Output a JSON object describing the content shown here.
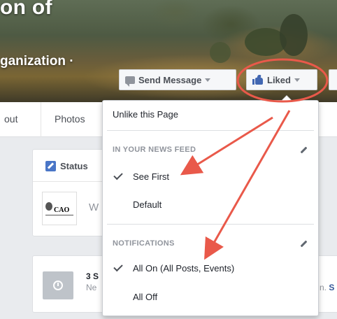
{
  "cover": {
    "title": "on of",
    "subtitle": "ganization ·"
  },
  "buttons": {
    "send_message": "Send Message",
    "liked": "Liked"
  },
  "nav": {
    "about_partial": "out",
    "photos": "Photos"
  },
  "status_card": {
    "tab_label": "Status",
    "logo_text": "CAO",
    "placeholder_partial": "W"
  },
  "event_card": {
    "title_partial": "3 S",
    "subtitle_partial": "Ne",
    "right_text_partial": "n.",
    "right_link_partial": "S"
  },
  "menu": {
    "unlike": "Unlike this Page",
    "news_feed_header": "IN YOUR NEWS FEED",
    "see_first": "See First",
    "default": "Default",
    "notifications_header": "NOTIFICATIONS",
    "all_on": "All On (All Posts, Events)",
    "all_off": "All Off"
  },
  "colors": {
    "annotation": "#e9594a",
    "brand": "#4267b2"
  },
  "icons": [
    "message-icon",
    "thumbs-up-icon",
    "caret-down-icon",
    "pencil-icon",
    "check-icon",
    "clock-icon"
  ]
}
